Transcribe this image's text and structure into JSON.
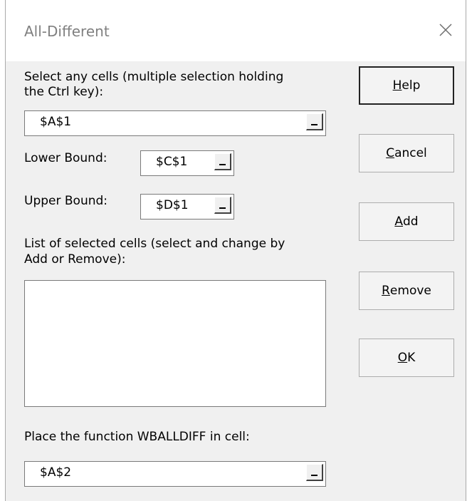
{
  "dialog": {
    "title": "All-Different"
  },
  "select_cells": {
    "label_line1": "Select any cells (multiple selection holding",
    "label_line2": "the Ctrl key):",
    "value": "$A$1"
  },
  "lower_bound": {
    "label": "Lower Bound:",
    "value": "$C$1"
  },
  "upper_bound": {
    "label": "Upper Bound:",
    "value": "$D$1"
  },
  "selected_list": {
    "label_line1": "List of selected cells (select and change by",
    "label_line2": "Add or Remove):",
    "items": []
  },
  "place_function": {
    "label": "Place the function WBALLDIFF in cell:",
    "value": "$A$2"
  },
  "buttons": {
    "help": {
      "mnemonic": "H",
      "rest": "elp"
    },
    "cancel": {
      "mnemonic": "C",
      "rest": "ancel"
    },
    "add": {
      "mnemonic": "A",
      "rest": "dd"
    },
    "remove": {
      "mnemonic": "R",
      "rest": "emove"
    },
    "ok": {
      "mnemonic": "O",
      "rest": "K"
    }
  },
  "icons": {
    "close": "close-icon",
    "range_picker": "range-picker-icon"
  }
}
